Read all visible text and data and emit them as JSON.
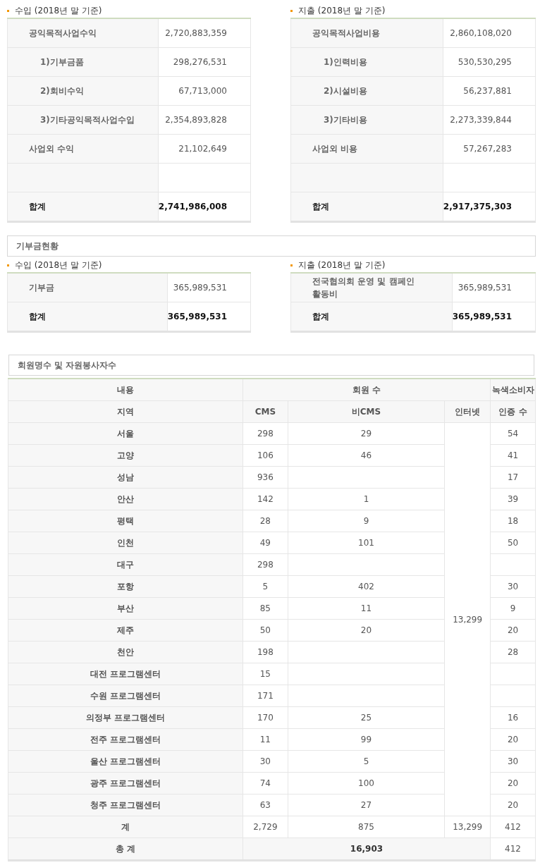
{
  "income": {
    "heading": "수입 (2018년 말 기준)",
    "rows": [
      {
        "kind": "main",
        "label": "공익목적사업수익",
        "value": "2,720,883,359"
      },
      {
        "kind": "sub",
        "label": "1)기부금품",
        "value": "298,276,531"
      },
      {
        "kind": "sub",
        "label": "2)회비수익",
        "value": "67,713,000"
      },
      {
        "kind": "sub",
        "label": "3)기타공익목적사업수입",
        "value": "2,354,893,828"
      },
      {
        "kind": "main",
        "label": "사업외 수익",
        "value": "21,102,649"
      },
      {
        "kind": "blank"
      },
      {
        "kind": "total",
        "label": "합계",
        "value": "2,741,986,008"
      }
    ]
  },
  "expense": {
    "heading": "지출 (2018년 말 기준)",
    "rows": [
      {
        "kind": "main",
        "label": "공익목적사업비용",
        "value": "2,860,108,020"
      },
      {
        "kind": "sub",
        "label": "1)인력비용",
        "value": "530,530,295"
      },
      {
        "kind": "sub",
        "label": "2)시설비용",
        "value": "56,237,881"
      },
      {
        "kind": "sub",
        "label": "3)기타비용",
        "value": "2,273,339,844"
      },
      {
        "kind": "main",
        "label": "사업외 비용",
        "value": "57,267,283"
      },
      {
        "kind": "blank"
      },
      {
        "kind": "total",
        "label": "합계",
        "value": "2,917,375,303"
      }
    ]
  },
  "donation": {
    "title": "기부금현황",
    "income": {
      "heading": "수입 (2018년 말 기준)",
      "rows": [
        {
          "kind": "main",
          "label": "기부금",
          "value": "365,989,531"
        },
        {
          "kind": "total",
          "label": "합계",
          "value": "365,989,531"
        }
      ]
    },
    "expense": {
      "heading": "지출 (2018년 말 기준)",
      "rows": [
        {
          "kind": "main",
          "label": "전국협의회 운영 및 캠페인 활동비",
          "value": "365,989,531"
        },
        {
          "kind": "total",
          "label": "합계",
          "value": "365,989,531"
        }
      ]
    }
  },
  "members": {
    "title": "회원명수 및 자원봉사자수",
    "header_top": [
      "내용",
      "회원 수",
      "녹색소비자"
    ],
    "header_sub": [
      "지역",
      "CMS",
      "비CMS",
      "인터넷",
      "인증 수"
    ],
    "internet": "13,299",
    "rows": [
      {
        "region": "서울",
        "cms": "298",
        "non_cms": "29",
        "certified": "54"
      },
      {
        "region": "고양",
        "cms": "106",
        "non_cms": "46",
        "certified": "41"
      },
      {
        "region": "성남",
        "cms": "936",
        "certified": "17"
      },
      {
        "region": "안산",
        "cms": "142",
        "non_cms": "1",
        "certified": "39"
      },
      {
        "region": "평택",
        "cms": "28",
        "non_cms": "9",
        "certified": "18"
      },
      {
        "region": "인천",
        "cms": "49",
        "non_cms": "101",
        "certified": "50"
      },
      {
        "region": "대구",
        "cms": "298"
      },
      {
        "region": "포항",
        "cms": "5",
        "non_cms": "402",
        "certified": "30"
      },
      {
        "region": "부산",
        "cms": "85",
        "non_cms": "11",
        "certified": "9"
      },
      {
        "region": "제주",
        "cms": "50",
        "non_cms": "20",
        "certified": "20"
      },
      {
        "region": "천안",
        "cms": "198",
        "certified": "28"
      },
      {
        "region": "대전 프로그램센터",
        "cms": "15"
      },
      {
        "region": "수원 프로그램센터",
        "cms": "171"
      },
      {
        "region": "의정부 프로그램센터",
        "cms": "170",
        "non_cms": "25",
        "certified": "16"
      },
      {
        "region": "전주 프로그램센터",
        "cms": "11",
        "non_cms": "99",
        "certified": "20"
      },
      {
        "region": "울산 프로그램센터",
        "cms": "30",
        "non_cms": "5",
        "certified": "30"
      },
      {
        "region": "광주 프로그램센터",
        "cms": "74",
        "non_cms": "100",
        "certified": "20"
      },
      {
        "region": "청주 프로그램센터",
        "cms": "63",
        "non_cms": "27",
        "certified": "20"
      }
    ],
    "subtotal": {
      "label": "계",
      "cms": "2,729",
      "non_cms": "875",
      "internet": "13,299",
      "certified": "412"
    },
    "grand_total": {
      "label": "총 계",
      "members": "16,903",
      "certified": "412"
    }
  }
}
